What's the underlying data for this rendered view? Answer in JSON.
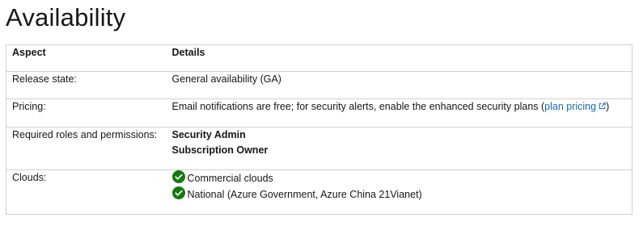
{
  "page": {
    "title": "Availability"
  },
  "table": {
    "headers": {
      "aspect": "Aspect",
      "details": "Details"
    },
    "release": {
      "aspect": "Release state:",
      "details": "General availability (GA)"
    },
    "pricing": {
      "aspect": "Pricing:",
      "details_prefix": "Email notifications are free; for security alerts, enable the enhanced security plans (",
      "link_text": "plan pricing",
      "details_suffix": ")"
    },
    "roles": {
      "aspect": "Required roles and permissions:",
      "items": [
        "Security Admin",
        "Subscription Owner"
      ]
    },
    "clouds": {
      "aspect": "Clouds:",
      "items": [
        "Commercial clouds",
        "National (Azure Government, Azure China 21Vianet)"
      ]
    }
  },
  "colors": {
    "link": "#0f6cbd",
    "check": "#107c10",
    "border": "#d1d1d1",
    "text": "#171717"
  },
  "icons": {
    "external_link": "external-link-icon",
    "check": "checkmark-circle-icon"
  }
}
